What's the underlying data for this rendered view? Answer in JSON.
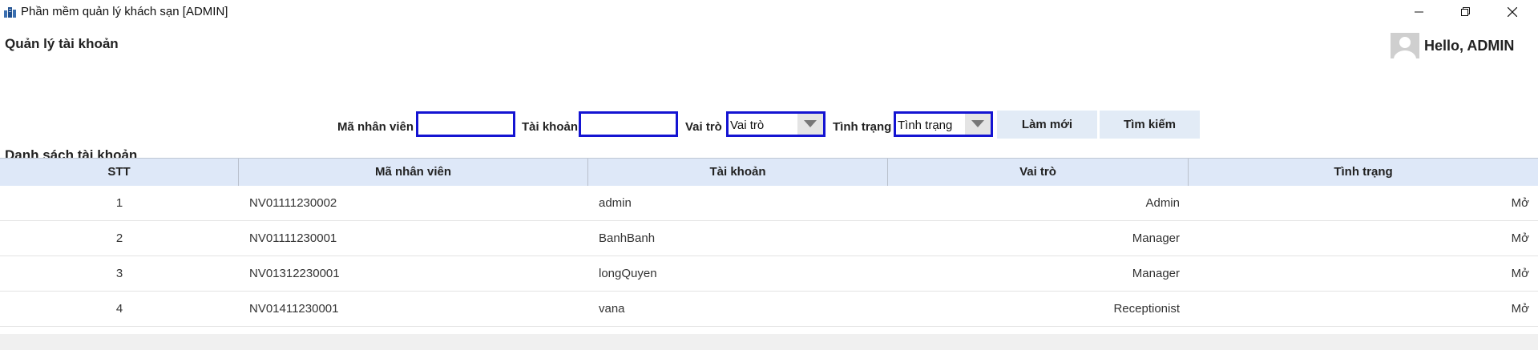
{
  "window": {
    "title": "Phần mềm quản lý khách sạn [ADMIN]",
    "app_icon": "hotel-icon",
    "controls": [
      "minimize-icon",
      "restore-icon",
      "close-icon"
    ]
  },
  "header": {
    "page_title": "Quản lý tài khoản",
    "greeting": "Hello, ADMIN",
    "avatar_icon": "user-avatar-icon"
  },
  "filters": {
    "employee_id_label": "Mã nhân viên",
    "employee_id_value": "",
    "account_label": "Tài khoản",
    "account_value": "",
    "role_label": "Vai trò",
    "role_selected": "Vai trò",
    "status_label": "Tình trạng",
    "status_selected": "Tình trạng",
    "refresh_button": "Làm mới",
    "search_button": "Tìm kiếm"
  },
  "table": {
    "title": "Danh sách tài khoản",
    "columns": [
      "STT",
      "Mã nhân viên",
      "Tài khoản",
      "Vai trò",
      "Tình trạng"
    ],
    "rows": [
      {
        "stt": "1",
        "employee_id": "NV01111230002",
        "account": "admin",
        "role": "Admin",
        "status": "Mở"
      },
      {
        "stt": "2",
        "employee_id": "NV01111230001",
        "account": "BanhBanh",
        "role": "Manager",
        "status": "Mở"
      },
      {
        "stt": "3",
        "employee_id": "NV01312230001",
        "account": "longQuyen",
        "role": "Manager",
        "status": "Mở"
      },
      {
        "stt": "4",
        "employee_id": "NV01411230001",
        "account": "vana",
        "role": "Receptionist",
        "status": "Mở"
      }
    ]
  },
  "colors": {
    "input_border": "#1414d2",
    "header_bg": "#dee8f8",
    "button_bg": "#e2ebf6"
  }
}
